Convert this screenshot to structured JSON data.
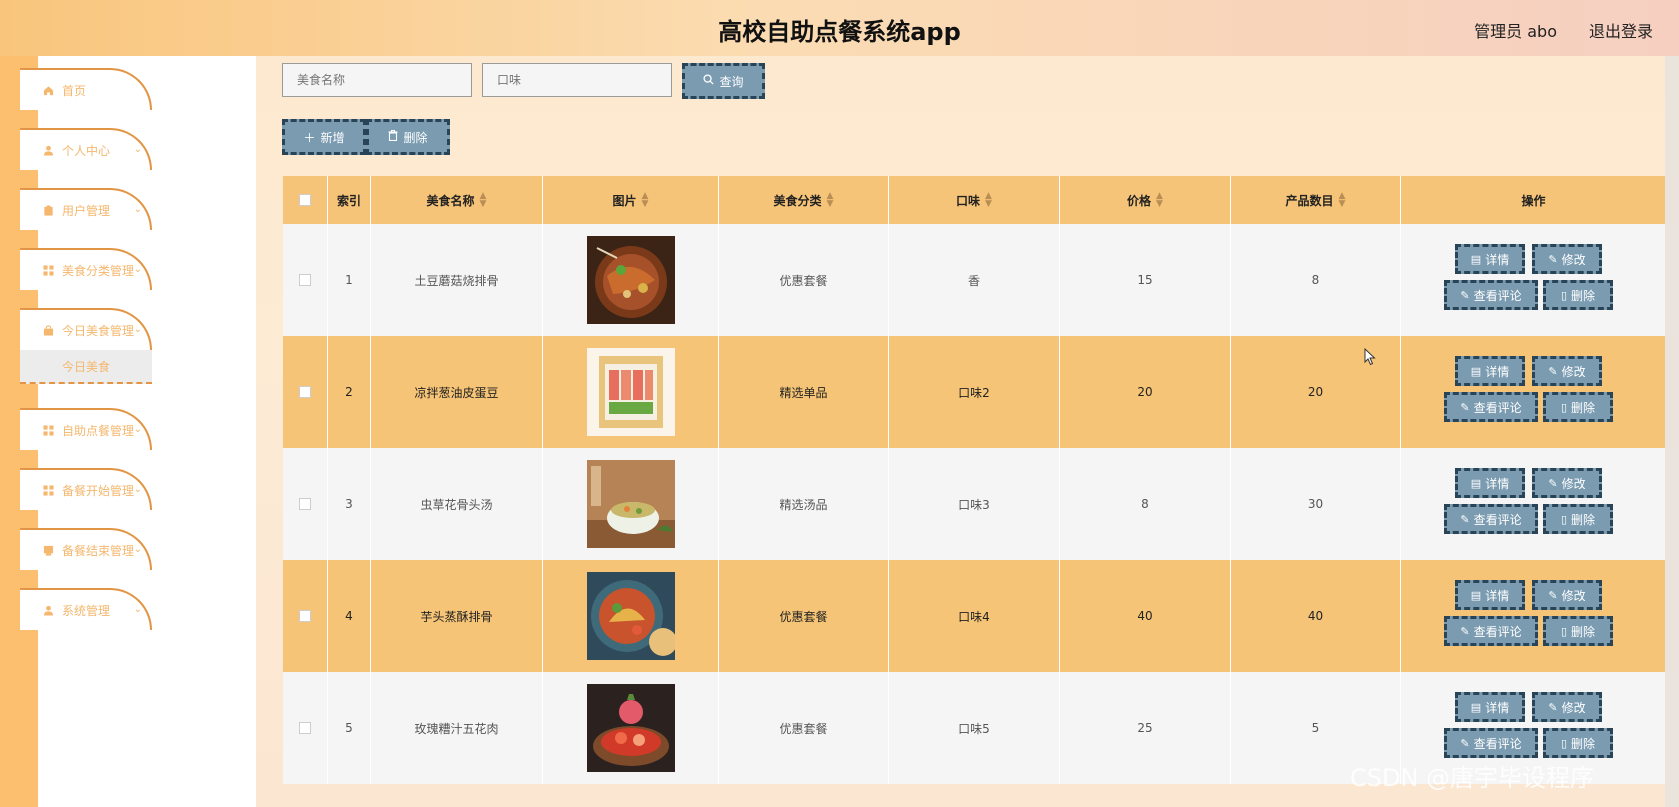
{
  "header": {
    "title": "高校自助点餐系统app",
    "user": "管理员 abo",
    "logout": "退出登录"
  },
  "sidebar": {
    "items": [
      {
        "label": "首页",
        "icon": "home-icon"
      },
      {
        "label": "个人中心",
        "icon": "user-icon"
      },
      {
        "label": "用户管理",
        "icon": "clipboard-icon"
      },
      {
        "label": "美食分类管理",
        "icon": "grid-icon"
      },
      {
        "label": "今日美食管理",
        "icon": "bag-icon"
      },
      {
        "label": "自助点餐管理",
        "icon": "grid-icon"
      },
      {
        "label": "备餐开始管理",
        "icon": "grid-icon"
      },
      {
        "label": "备餐结束管理",
        "icon": "card-icon"
      },
      {
        "label": "系统管理",
        "icon": "user-icon"
      }
    ],
    "submenu": "今日美食"
  },
  "search": {
    "name_placeholder": "美食名称",
    "taste_placeholder": "口味",
    "search_label": "查询"
  },
  "toolbar": {
    "add_label": "新增",
    "delete_label": "删除"
  },
  "table": {
    "headers": [
      "索引",
      "美食名称",
      "图片",
      "美食分类",
      "口味",
      "价格",
      "产品数目",
      "操作"
    ],
    "rows": [
      {
        "index": "1",
        "name": "土豆蘑菇烧排骨",
        "category": "优惠套餐",
        "taste": "香",
        "price": "15",
        "count": "8"
      },
      {
        "index": "2",
        "name": "凉拌葱油皮蛋豆",
        "category": "精选单品",
        "taste": "口味2",
        "price": "20",
        "count": "20"
      },
      {
        "index": "3",
        "name": "虫草花骨头汤",
        "category": "精选汤品",
        "taste": "口味3",
        "price": "8",
        "count": "30"
      },
      {
        "index": "4",
        "name": "芋头蒸酥排骨",
        "category": "优惠套餐",
        "taste": "口味4",
        "price": "40",
        "count": "40"
      },
      {
        "index": "5",
        "name": "玫瑰糟汁五花肉",
        "category": "优惠套餐",
        "taste": "口味5",
        "price": "25",
        "count": "5"
      }
    ],
    "ops": {
      "detail": "详情",
      "edit": "修改",
      "review": "查看评论",
      "delete": "删除"
    }
  },
  "watermark": "CSDN @唐宇毕设程序"
}
